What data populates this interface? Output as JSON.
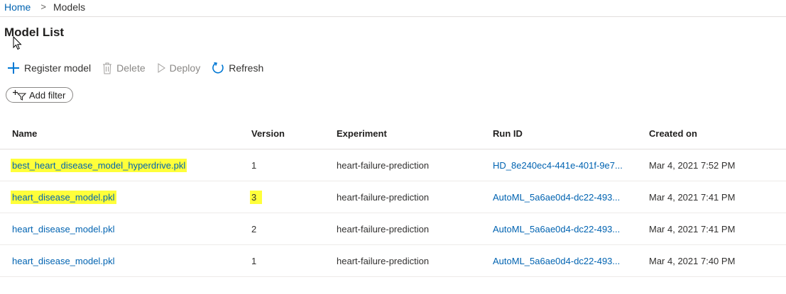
{
  "breadcrumb": {
    "home": "Home",
    "separator": ">",
    "current": "Models"
  },
  "page_title": "Model List",
  "toolbar": {
    "register": "Register model",
    "delete": "Delete",
    "deploy": "Deploy",
    "refresh": "Refresh"
  },
  "filter": {
    "label": "Add filter"
  },
  "table": {
    "headers": {
      "name": "Name",
      "version": "Version",
      "experiment": "Experiment",
      "run_id": "Run ID",
      "created_on": "Created on"
    },
    "rows": [
      {
        "name": "best_heart_disease_model_hyperdrive.pkl",
        "version": "1",
        "experiment": "heart-failure-prediction",
        "run_id": "HD_8e240ec4-441e-401f-9e7...",
        "created_on": "Mar 4, 2021 7:52 PM"
      },
      {
        "name": "heart_disease_model.pkl",
        "version": "3",
        "experiment": "heart-failure-prediction",
        "run_id": "AutoML_5a6ae0d4-dc22-493...",
        "created_on": "Mar 4, 2021 7:41 PM"
      },
      {
        "name": "heart_disease_model.pkl",
        "version": "2",
        "experiment": "heart-failure-prediction",
        "run_id": "AutoML_5a6ae0d4-dc22-493...",
        "created_on": "Mar 4, 2021 7:41 PM"
      },
      {
        "name": "heart_disease_model.pkl",
        "version": "1",
        "experiment": "heart-failure-prediction",
        "run_id": "AutoML_5a6ae0d4-dc22-493...",
        "created_on": "Mar 4, 2021 7:40 PM"
      }
    ]
  },
  "colors": {
    "link": "#0063b1",
    "highlight": "#ffff3a",
    "accent": "#0078d4"
  }
}
